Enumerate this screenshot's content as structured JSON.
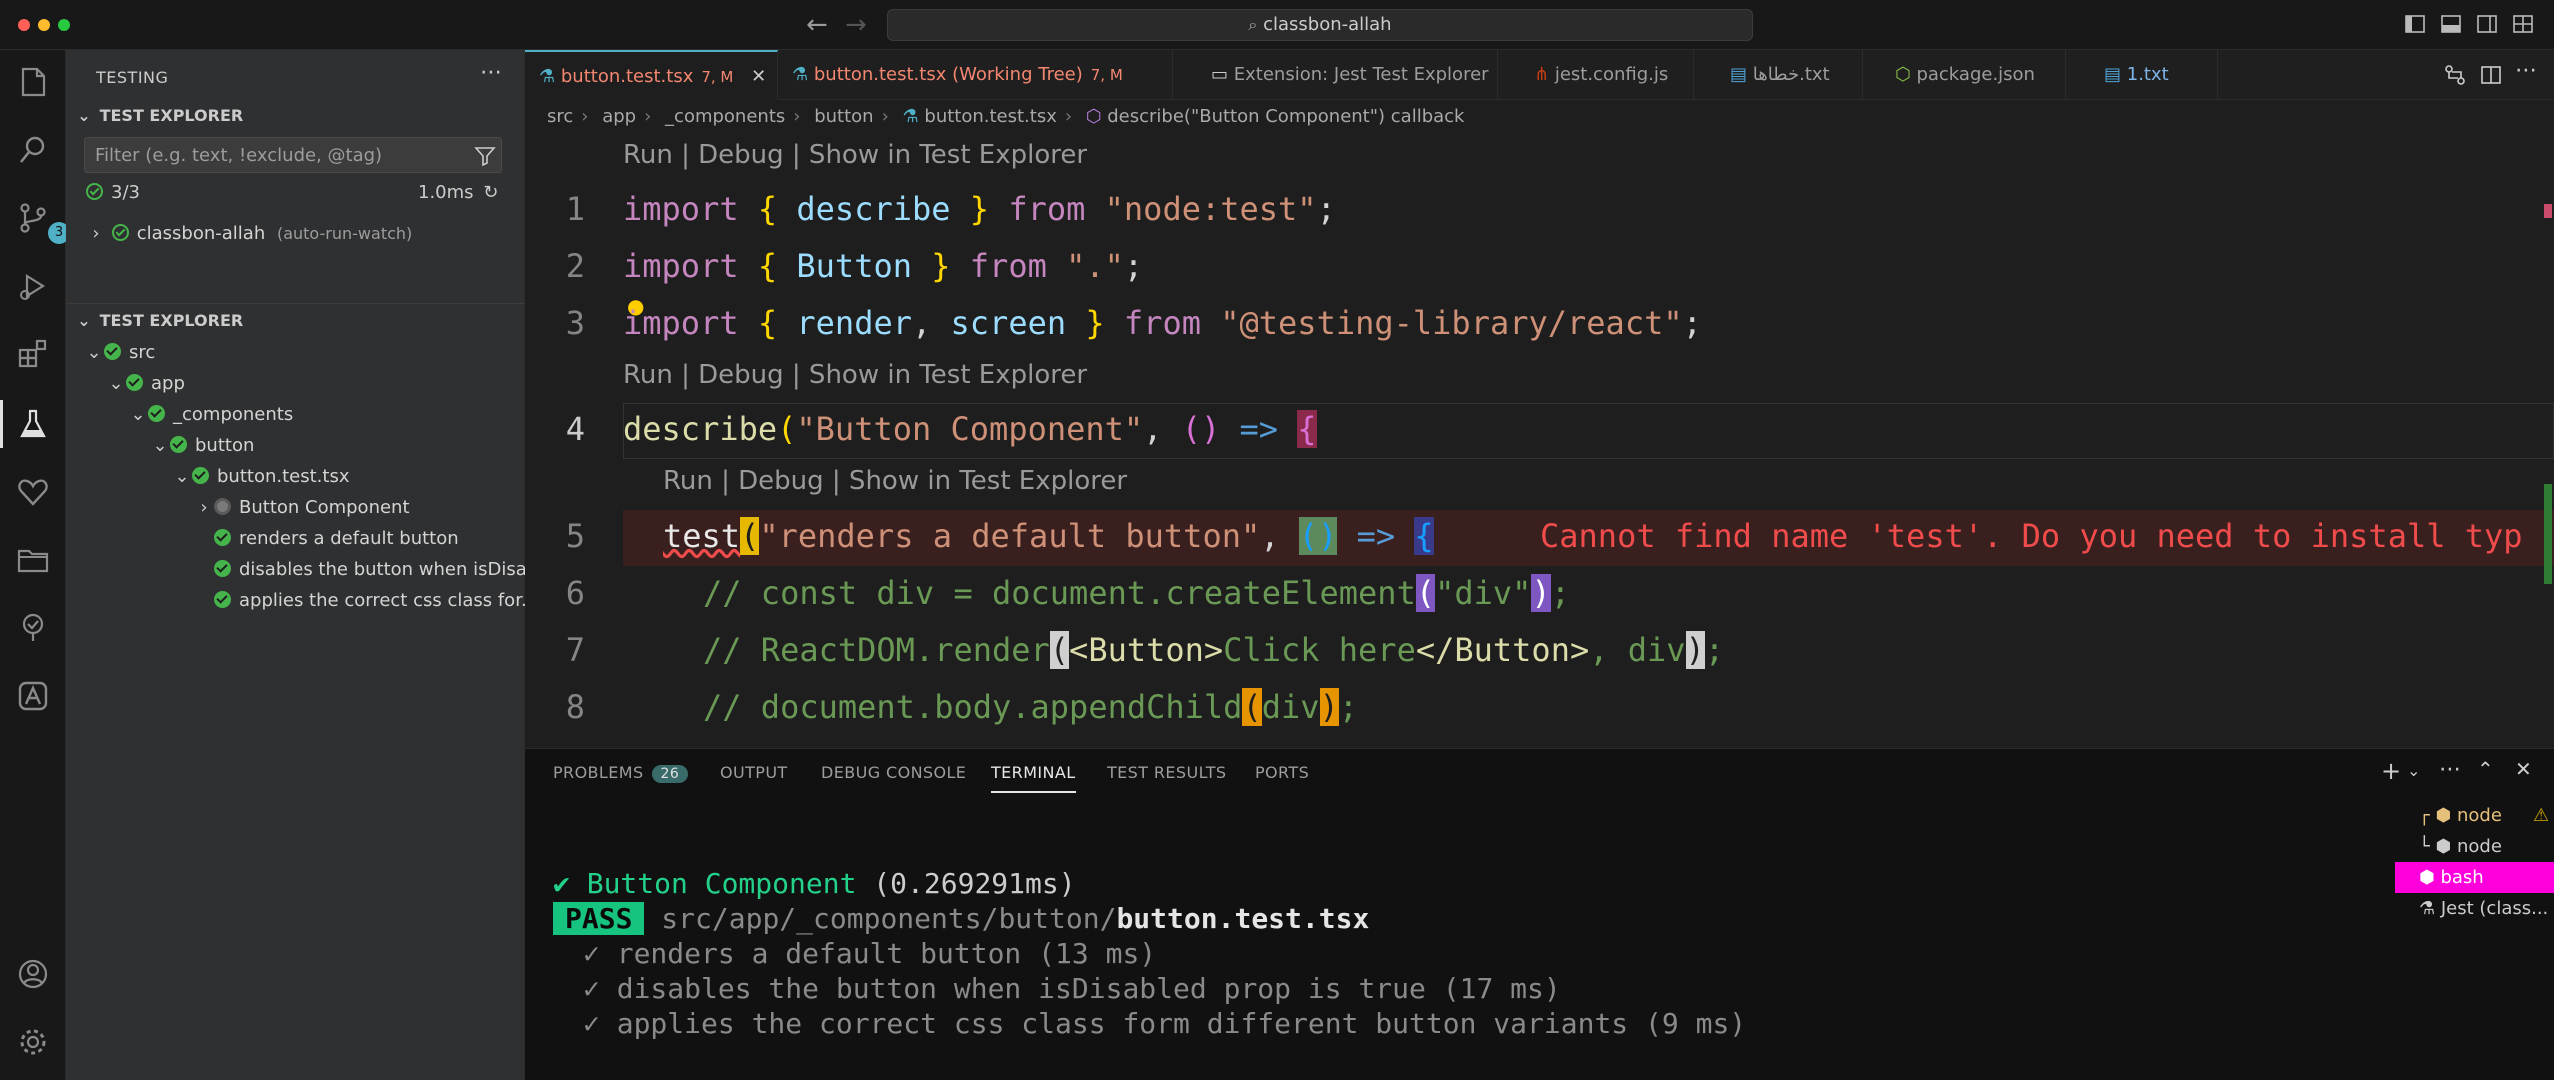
{
  "window": {
    "search_text": "classbon-allah",
    "accent": "#4fb0c6"
  },
  "activity": {
    "scm_badge": "3"
  },
  "sidebar": {
    "title": "TESTING",
    "section1": "TEST EXPLORER",
    "filter_placeholder": "Filter (e.g. text, !exclude, @tag)",
    "summary_count": "3/3",
    "summary_time": "1.0ms",
    "workspace_name": "classbon-allah",
    "workspace_mode": "(auto-run-watch)",
    "section2": "TEST EXPLORER",
    "tree": [
      {
        "label": "src",
        "depth": 0
      },
      {
        "label": "app",
        "depth": 1
      },
      {
        "label": "_components",
        "depth": 2
      },
      {
        "label": "button",
        "depth": 3
      },
      {
        "label": "button.test.tsx",
        "depth": 4
      },
      {
        "label": "Button Component",
        "depth": 5
      },
      {
        "label": "renders a default button",
        "depth": 5
      },
      {
        "label": "disables the button when isDisa...",
        "depth": 5
      },
      {
        "label": "applies the correct css class for...",
        "depth": 5
      }
    ]
  },
  "tabs": [
    {
      "label": "button.test.tsx",
      "mod": "7, M"
    },
    {
      "label": "button.test.tsx (Working Tree)",
      "mod": "7, M"
    },
    {
      "label": "Extension: Jest Test Explorer"
    },
    {
      "label": "jest.config.js"
    },
    {
      "label": "خطاها.txt"
    },
    {
      "label": "package.json"
    },
    {
      "label": "1.txt"
    }
  ],
  "breadcrumb": [
    "src",
    "app",
    "_components",
    "button",
    "button.test.tsx",
    "describe(\"Button Component\") callback"
  ],
  "editor": {
    "codelens": "Run | Debug | Show in Test Explorer",
    "line_numbers": [
      "1",
      "2",
      "3",
      "4",
      "5",
      "6",
      "7",
      "8"
    ],
    "error_message": "Cannot find name 'test'. Do you need to install typ"
  },
  "panel": {
    "tabs": [
      "PROBLEMS",
      "OUTPUT",
      "DEBUG CONSOLE",
      "TERMINAL",
      "TEST RESULTS",
      "PORTS"
    ],
    "problems_count": "26",
    "terminal": {
      "suite_line": "✔ Button Component",
      "suite_time": "(0.269291ms)",
      "pass_label": "PASS",
      "path_dir": "src/app/_components/button/",
      "path_file": "button.test.tsx",
      "results": [
        "✓ renders a default button (13 ms)",
        "✓ disables the button when isDisabled prop is true (17 ms)",
        "✓ applies the correct css class form different button variants (9 ms)"
      ]
    },
    "terminals": [
      {
        "label": "node"
      },
      {
        "label": "node"
      },
      {
        "label": "bash"
      },
      {
        "label": "Jest (class..."
      }
    ]
  }
}
